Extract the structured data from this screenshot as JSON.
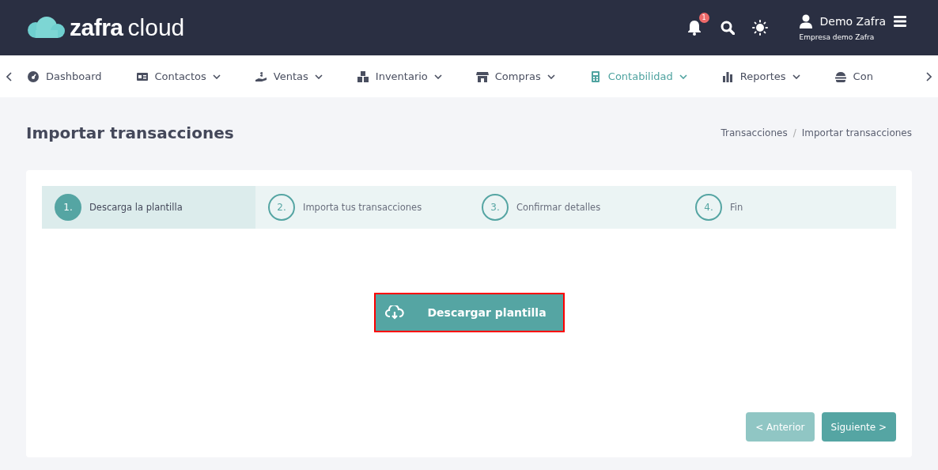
{
  "header": {
    "logo": {
      "bold": "zafra",
      "light": "cloud"
    },
    "notification_count": "1",
    "user": {
      "name": "Demo Zafra",
      "company": "Empresa demo Zafra"
    }
  },
  "nav": {
    "items": [
      {
        "label": "Dashboard",
        "has_menu": false,
        "selected": false
      },
      {
        "label": "Contactos",
        "has_menu": true,
        "selected": false
      },
      {
        "label": "Ventas",
        "has_menu": true,
        "selected": false
      },
      {
        "label": "Inventario",
        "has_menu": true,
        "selected": false
      },
      {
        "label": "Compras",
        "has_menu": true,
        "selected": false
      },
      {
        "label": "Contabilidad",
        "has_menu": true,
        "selected": true
      },
      {
        "label": "Reportes",
        "has_menu": true,
        "selected": false
      },
      {
        "label": "Con",
        "has_menu": false,
        "selected": false
      }
    ]
  },
  "page": {
    "title": "Importar transacciones",
    "breadcrumb": [
      "Transacciones",
      "Importar transacciones"
    ],
    "breadcrumb_separator": "/"
  },
  "wizard": {
    "steps": [
      {
        "number": "1.",
        "label": "Descarga la plantilla",
        "selected": true
      },
      {
        "number": "2.",
        "label": "Importa tus transacciones",
        "selected": false
      },
      {
        "number": "3.",
        "label": "Confirmar detalles",
        "selected": false
      },
      {
        "number": "4.",
        "label": "Fin",
        "selected": false
      }
    ],
    "download_button": "Descargar plantilla",
    "buttons": [
      {
        "label": "< Anterior",
        "disabled": true
      },
      {
        "label": "Siguiente >",
        "disabled": false
      }
    ]
  }
}
